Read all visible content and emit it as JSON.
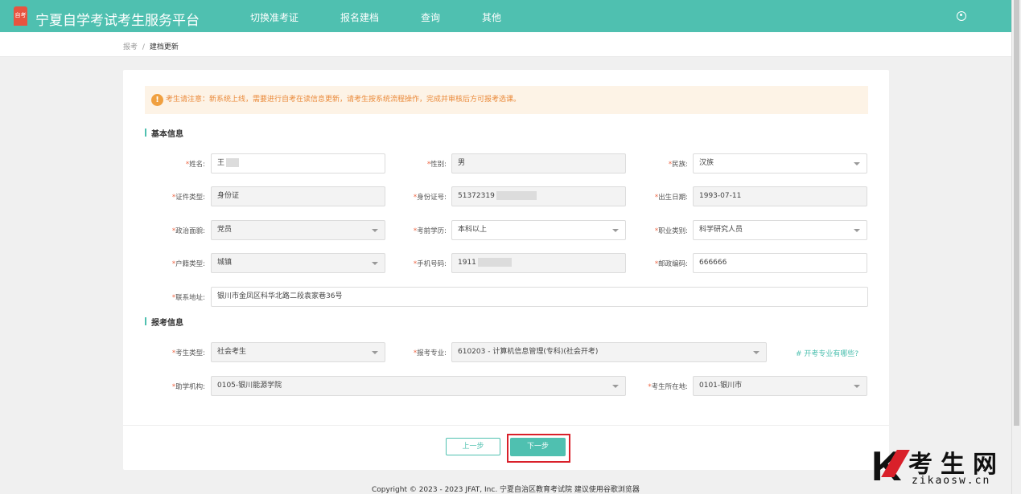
{
  "header": {
    "logo_text": "自考",
    "title": "宁夏自学考试考生服务平台",
    "nav": [
      "切换准考证",
      "报名建档",
      "查询",
      "其他"
    ]
  },
  "breadcrumb": {
    "parent": "报考",
    "separator": "/",
    "current": "建档更新"
  },
  "notice": {
    "text": "考生请注意：新系统上线，需要进行自考在读信息更新，请考生按系统流程操作，完成并审核后方可报考选课。"
  },
  "basic_info": {
    "section_title": "基本信息",
    "name_label": "姓名:",
    "name_value": "王",
    "gender_label": "性别:",
    "gender_value": "男",
    "ethnicity_label": "民族:",
    "ethnicity_value": "汉族",
    "id_type_label": "证件类型:",
    "id_type_value": "身份证",
    "id_no_label": "身份证号:",
    "id_no_value": "51372319",
    "birth_label": "出生日期:",
    "birth_value": "1993-07-11",
    "politics_label": "政治面貌:",
    "politics_value": "党员",
    "education_label": "考前学历:",
    "education_value": "本科以上",
    "occupation_label": "职业类别:",
    "occupation_value": "科学研究人员",
    "household_label": "户籍类型:",
    "household_value": "城镇",
    "phone_label": "手机号码:",
    "phone_value": "1911",
    "postcode_label": "邮政编码:",
    "postcode_value": "666666",
    "address_label": "联系地址:",
    "address_value": "银川市金凤区科华北路二段袁家巷36号"
  },
  "exam_info": {
    "section_title": "报考信息",
    "candidate_type_label": "考生类型:",
    "candidate_type_value": "社会考生",
    "major_label": "报考专业:",
    "major_value": "610203 - 计算机信息管理(专科)(社会开考)",
    "major_help": "# 开考专业有哪些?",
    "institution_label": "助学机构:",
    "institution_value": "0105-银川能源学院",
    "location_label": "考生所在地:",
    "location_value": "0101-银川市"
  },
  "actions": {
    "prev": "上一步",
    "next": "下一步"
  },
  "footer": {
    "copyright": "Copyright © 2023 - 2023 JFAT, Inc. 宁夏自治区教育考试院 建议使用谷歌浏览器"
  },
  "watermark": {
    "letter": "K",
    "cn": "考生网",
    "en": "zikaosw.cn"
  },
  "colors": {
    "brand": "#4fc0b0",
    "notice_text": "#ea8a3a",
    "highlight": "#d9202a"
  }
}
